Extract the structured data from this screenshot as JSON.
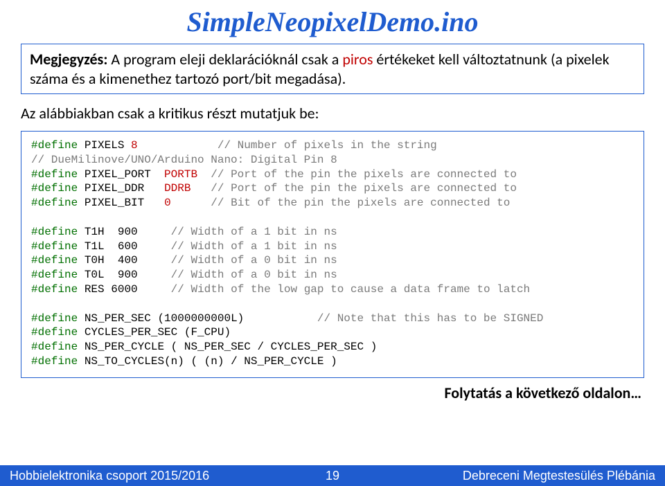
{
  "title": "SimpleNeopixelDemo.ino",
  "note": {
    "label": "Megjegyzés:",
    "text_pre": "A program eleji deklarációknál csak a ",
    "text_red": "piros",
    "text_post": " értékeket kell változtatnunk (a pixelek száma és a kimenethez tartozó port/bit megadása)."
  },
  "lead": "Az alábbiakban csak a kritikus részt mutatjuk be:",
  "code": {
    "l1": {
      "def": "#define",
      "id": "PIXELS",
      "val": "8",
      "cm": "// Number of pixels in the string"
    },
    "l2": {
      "cm": "// DueMilinove/UNO/Arduino Nano: Digital Pin 8"
    },
    "l3": {
      "def": "#define",
      "id": "PIXEL_PORT",
      "val": "PORTB",
      "cm": "// Port of the pin the pixels are connected to"
    },
    "l4": {
      "def": "#define",
      "id": "PIXEL_DDR",
      "val": "DDRB",
      "cm": "// Port of the pin the pixels are connected to"
    },
    "l5": {
      "def": "#define",
      "id": "PIXEL_BIT",
      "val": "0",
      "cm": "// Bit of the pin the pixels are connected to"
    },
    "l6": {
      "def": "#define",
      "id": "T1H",
      "val": "900",
      "cm": "// Width of a 1 bit in ns"
    },
    "l7": {
      "def": "#define",
      "id": "T1L",
      "val": "600",
      "cm": "// Width of a 1 bit in ns"
    },
    "l8": {
      "def": "#define",
      "id": "T0H",
      "val": "400",
      "cm": "// Width of a 0 bit in ns"
    },
    "l9": {
      "def": "#define",
      "id": "T0L",
      "val": "900",
      "cm": "// Width of a 0 bit in ns"
    },
    "l10": {
      "def": "#define",
      "id": "RES",
      "val": "6000",
      "cm": "// Width of the low gap to cause a data frame to latch"
    },
    "l11": {
      "def": "#define",
      "id": "NS_PER_SEC (1000000000L)",
      "cm": "// Note that this has to be SIGNED"
    },
    "l12": {
      "def": "#define",
      "id": "CYCLES_PER_SEC (F_CPU)"
    },
    "l13": {
      "def": "#define",
      "id": "NS_PER_CYCLE ( NS_PER_SEC / CYCLES_PER_SEC )"
    },
    "l14": {
      "def": "#define",
      "id": "NS_TO_CYCLES(n) ( (n) / NS_PER_CYCLE )"
    }
  },
  "cont": "Folytatás a következő oldalon…",
  "footer": {
    "left": "Hobbielektronika csoport 2015/2016",
    "center": "19",
    "right": "Debreceni Megtestesülés Plébánia"
  }
}
